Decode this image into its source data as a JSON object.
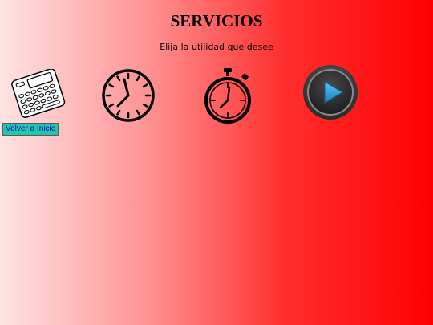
{
  "page": {
    "title": "SERVICIOS",
    "subtitle": "Elija la utilidad que desee"
  },
  "utilities": [
    {
      "name": "calculator",
      "icon": "calculator-icon"
    },
    {
      "name": "clock",
      "icon": "clock-icon"
    },
    {
      "name": "stopwatch",
      "icon": "stopwatch-icon"
    },
    {
      "name": "player",
      "icon": "play-button-icon"
    }
  ],
  "nav": {
    "back_label": "Volver a Inicio"
  },
  "colors": {
    "background_start": "#ffe4e4",
    "background_end": "#ff0000",
    "back_button_bg": "#22c7a9",
    "back_button_text": "#0000cc",
    "play_icon": "#2a9fd6"
  }
}
